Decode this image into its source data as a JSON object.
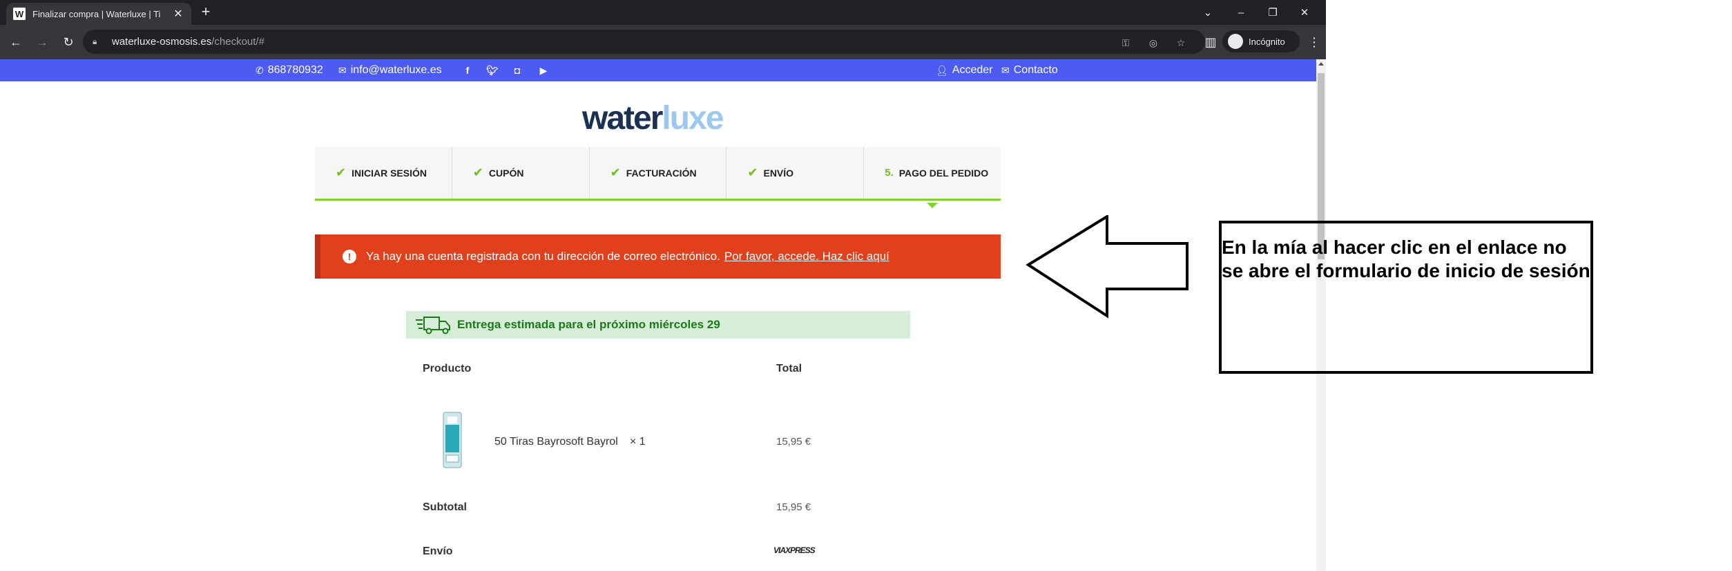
{
  "browser": {
    "tab_title": "Finalizar compra | Waterluxe | Ti",
    "favicon_letter": "W",
    "new_tab": "+",
    "url_host": "waterluxe-osmosis.es",
    "url_path": "/checkout/#",
    "incognito_label": "Incógnito"
  },
  "topbar": {
    "phone": "868780932",
    "email": "info@waterluxe.es",
    "login": "Acceder",
    "contact": "Contacto"
  },
  "logo": {
    "part1": "water",
    "part2": "luxe"
  },
  "steps": [
    {
      "label": "INICIAR SESIÓN",
      "state": "done"
    },
    {
      "label": "CUPÓN",
      "state": "done"
    },
    {
      "label": "FACTURACIÓN",
      "state": "done"
    },
    {
      "label": "ENVÍO",
      "state": "done"
    },
    {
      "number": "5.",
      "label": "PAGO DEL PEDIDO",
      "state": "current"
    }
  ],
  "alert": {
    "text": "Ya hay una cuenta registrada con tu dirección de correo electrónico.",
    "link": "Por favor, accede. Haz clic aquí"
  },
  "delivery": "Entrega estimada para el próximo miércoles 29",
  "order": {
    "col_product": "Producto",
    "col_total": "Total",
    "item_name": "50 Tiras Bayrosoft Bayrol",
    "item_qty": "× 1",
    "item_total": "15,95 €",
    "subtotal_label": "Subtotal",
    "subtotal_value": "15,95 €",
    "shipping_label": "Envío",
    "shipping_carrier": "VIAXPRESS"
  },
  "annotation": {
    "text": "En la mía al hacer clic en el enlace no se abre el formulario de inicio de sesión"
  }
}
